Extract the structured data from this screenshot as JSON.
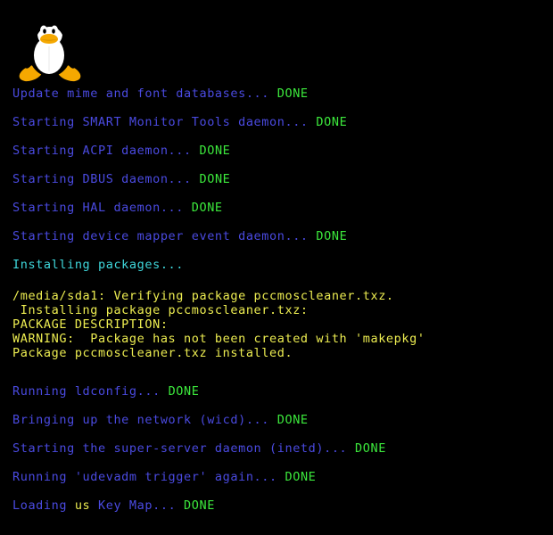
{
  "screen": {
    "background": "#000000",
    "colors": {
      "service": "#4a4ae0",
      "done": "#3ce83c",
      "section": "#3fd8dc",
      "package": "#eded51"
    }
  },
  "logo": {
    "name": "tux-penguin-logo",
    "body_color": "#000000",
    "belly_color": "#ffffff",
    "beak_color": "#f5a800",
    "feet_color": "#f5a800",
    "eye_color": "#ffffff",
    "pupil_color": "#000000"
  },
  "boot_log": {
    "services_top": [
      {
        "label": "Update mime and font databases...",
        "status": "DONE"
      },
      {
        "label": "Starting SMART Monitor Tools daemon...",
        "status": "DONE"
      },
      {
        "label": "Starting ACPI daemon...",
        "status": "DONE"
      },
      {
        "label": "Starting DBUS daemon...",
        "status": "DONE"
      },
      {
        "label": "Starting HAL daemon...",
        "status": "DONE"
      },
      {
        "label": "Starting device mapper event daemon...",
        "status": "DONE"
      }
    ],
    "section_header": "Installing packages...",
    "package_output": [
      "/media/sda1: Verifying package pccmoscleaner.txz.",
      " Installing package pccmoscleaner.txz:",
      "PACKAGE DESCRIPTION:",
      "WARNING:  Package has not been created with 'makepkg'",
      "Package pccmoscleaner.txz installed."
    ],
    "services_bottom": [
      {
        "label": "Running ldconfig...",
        "status": "DONE"
      },
      {
        "label": "Bringing up the network (wicd)...",
        "status": "DONE"
      },
      {
        "label": "Starting the super-server daemon (inetd)...",
        "status": "DONE"
      },
      {
        "label": "Running 'udevadm trigger' again...",
        "status": "DONE"
      }
    ],
    "keymap_line": {
      "prefix": "Loading ",
      "layout": "us",
      "suffix": " Key Map...",
      "status": "DONE"
    }
  }
}
